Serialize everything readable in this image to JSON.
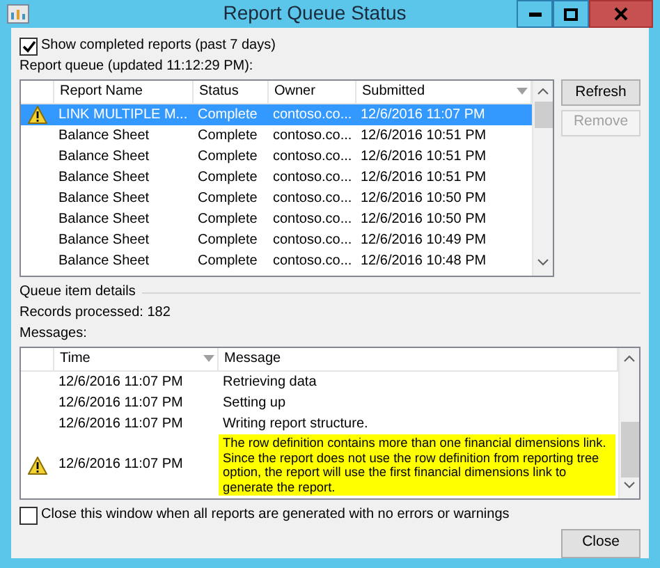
{
  "window": {
    "title": "Report Queue Status"
  },
  "show_completed": {
    "label": "Show completed reports (past 7 days)",
    "checked": true
  },
  "report_queue": {
    "label": "Report queue (updated 11:12:29 PM):",
    "columns": [
      {
        "label": "Report Name",
        "sorted": false
      },
      {
        "label": "Status",
        "sorted": false
      },
      {
        "label": "Owner",
        "sorted": false
      },
      {
        "label": "Submitted",
        "sorted": true
      }
    ],
    "rows": [
      {
        "warning": true,
        "selected": true,
        "cells": [
          "LINK MULTIPLE M...",
          "Complete",
          "contoso.co...",
          "12/6/2016 11:07 PM"
        ]
      },
      {
        "warning": false,
        "selected": false,
        "cells": [
          "Balance Sheet",
          "Complete",
          "contoso.co...",
          "12/6/2016 10:51 PM"
        ]
      },
      {
        "warning": false,
        "selected": false,
        "cells": [
          "Balance Sheet",
          "Complete",
          "contoso.co...",
          "12/6/2016 10:51 PM"
        ]
      },
      {
        "warning": false,
        "selected": false,
        "cells": [
          "Balance Sheet",
          "Complete",
          "contoso.co...",
          "12/6/2016 10:51 PM"
        ]
      },
      {
        "warning": false,
        "selected": false,
        "cells": [
          "Balance Sheet",
          "Complete",
          "contoso.co...",
          "12/6/2016 10:50 PM"
        ]
      },
      {
        "warning": false,
        "selected": false,
        "cells": [
          "Balance Sheet",
          "Complete",
          "contoso.co...",
          "12/6/2016 10:50 PM"
        ]
      },
      {
        "warning": false,
        "selected": false,
        "cells": [
          "Balance Sheet",
          "Complete",
          "contoso.co...",
          "12/6/2016 10:49 PM"
        ]
      },
      {
        "warning": false,
        "selected": false,
        "cells": [
          "Balance Sheet",
          "Complete",
          "contoso.co...",
          "12/6/2016 10:48 PM"
        ]
      }
    ]
  },
  "buttons": [
    {
      "label": "Refresh",
      "disabled": false
    },
    {
      "label": "Remove",
      "disabled": true
    }
  ],
  "details": {
    "label": "Queue item details",
    "records": "Records processed: 182",
    "messages_label": "Messages:"
  },
  "messages": {
    "columns": [
      {
        "label": "Time",
        "sorted": true
      },
      {
        "label": "Message",
        "sorted": false
      }
    ],
    "rows": [
      {
        "warning": false,
        "highlighted": false,
        "time": "12/6/2016 11:07 PM",
        "message": "Retrieving data"
      },
      {
        "warning": false,
        "highlighted": false,
        "time": "12/6/2016 11:07 PM",
        "message": "Setting up"
      },
      {
        "warning": false,
        "highlighted": false,
        "time": "12/6/2016 11:07 PM",
        "message": "Writing report structure."
      },
      {
        "warning": true,
        "highlighted": true,
        "time": "12/6/2016 11:07 PM",
        "message": "The row definition contains more than one financial dimensions link.  Since the report does not use the row definition from reporting tree option, the report will use the first financial dimensions link to generate the report."
      }
    ]
  },
  "close_when_done": {
    "label": "Close this window when all reports are generated with no errors or warnings",
    "checked": false
  },
  "close_button": {
    "label": "Close"
  }
}
